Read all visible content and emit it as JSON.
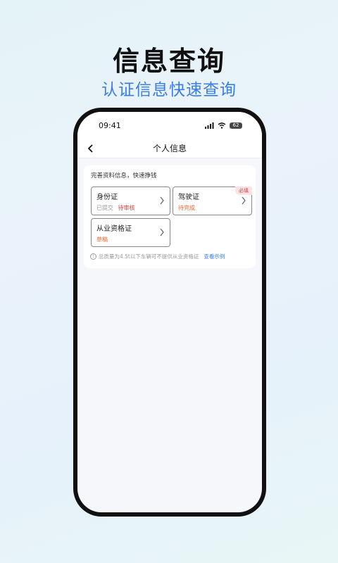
{
  "promo": {
    "headline": "信息查询",
    "subheadline": "认证信息快速查询"
  },
  "status_bar": {
    "time": "09:41",
    "battery": "62"
  },
  "nav": {
    "title": "个人信息"
  },
  "card": {
    "title": "完善资料信息，快速挣钱",
    "items": [
      {
        "label": "身份证",
        "submitted": "已提交",
        "status": "待审核",
        "status_color": "#e23b3b"
      },
      {
        "label": "驾驶证",
        "status": "待完成",
        "status_color": "#f0673a",
        "badge": "必填"
      },
      {
        "label": "从业资格证",
        "status": "草稿",
        "status_color": "#f0673a"
      }
    ],
    "note": "总质量为4.5t以下车辆可不提供从业资格证",
    "note_link": "查看示例"
  },
  "colors": {
    "accent": "#3a7de8",
    "error": "#e23b3b",
    "warning": "#f0673a"
  },
  "icons": [
    "back-arrow-icon",
    "signal-icon",
    "wifi-icon",
    "battery-icon",
    "chevron-right-icon",
    "info-icon"
  ]
}
